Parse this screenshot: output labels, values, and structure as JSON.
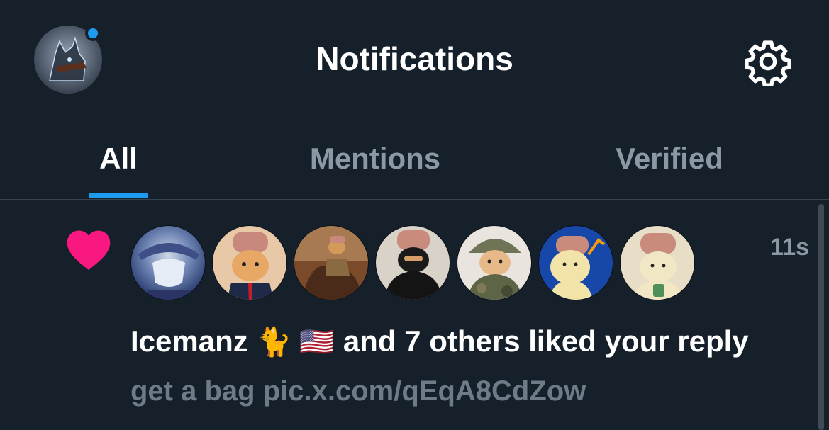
{
  "header": {
    "title": "Notifications",
    "has_unread_dot": true,
    "unread_dot_color": "#1d9bf0",
    "settings_icon": "gear-icon",
    "profile_icon": "avatar"
  },
  "tabs": [
    {
      "label": "All",
      "active": true
    },
    {
      "label": "Mentions",
      "active": false
    },
    {
      "label": "Verified",
      "active": false
    }
  ],
  "accent_color": "#1d9bf0",
  "notification": {
    "type_icon": "heart-icon",
    "type_icon_color": "#f91880",
    "timestamp": "11s",
    "actor_name": "Icemanz",
    "actor_emojis": "🐈 🇺🇸",
    "message_rest": "and 7 others liked your reply",
    "reply_preview": "get a bag pic.x.com/qEqA8CdZow",
    "avatars": [
      "avatar-anime-character",
      "avatar-cat-in-suit",
      "avatar-cat-on-horse",
      "avatar-cat-in-black-hoodie",
      "avatar-cat-in-camo",
      "avatar-cat-with-chart",
      "avatar-cat-holding-cash"
    ]
  }
}
